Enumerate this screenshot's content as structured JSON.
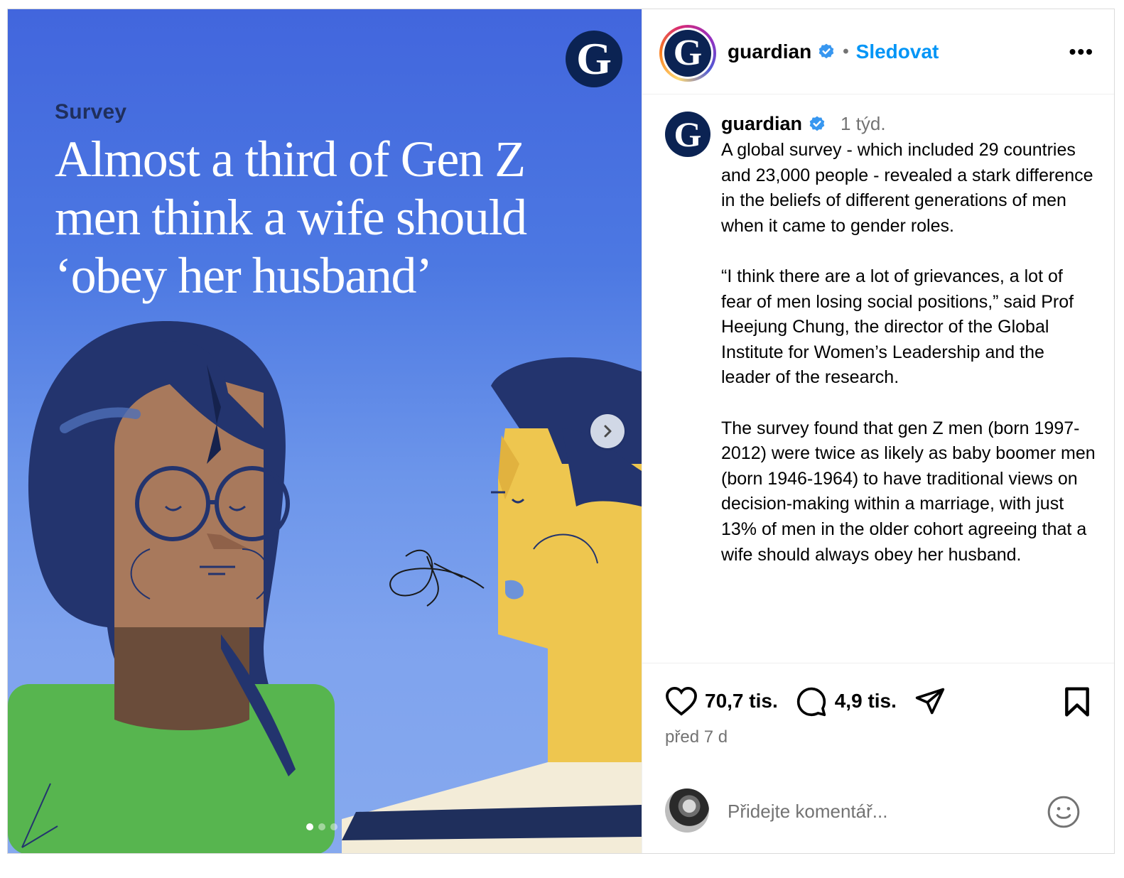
{
  "media": {
    "kicker": "Survey",
    "headline": "Almost a third of Gen Z men think a wife should ‘obey her husband’",
    "logo_letter": "G",
    "slide_count": 3,
    "active_slide": 1
  },
  "header": {
    "username": "guardian",
    "separator": "•",
    "follow_label": "Sledovat",
    "more_label": "•••",
    "avatar_letter": "G"
  },
  "caption": {
    "username": "guardian",
    "time": "1 týd.",
    "avatar_letter": "G",
    "text": "A global survey - which included 29 countries and 23,000 people - revealed a stark difference in the beliefs of different generations of men when it came to gender roles.\n\n“I think there are a lot of grievances, a lot of fear of men losing social positions,” said Prof Heejung Chung, the director of the Global Institute for Women’s Leadership and the leader of the research.\n\nThe survey found that gen Z men (born 1997-2012) were twice as likely as baby boomer men (born 1946-1964) to have traditional views on decision-making within a marriage, with just 13% of men in the older cohort agreeing that a wife should always obey her husband."
  },
  "actions": {
    "likes": "70,7 tis.",
    "comments": "4,9 tis.",
    "date": "před 7 d"
  },
  "comment": {
    "placeholder": "Přidejte komentář..."
  },
  "colors": {
    "brand_navy": "#0b2353",
    "follow_blue": "#0095f6",
    "verified_blue": "#3897f0",
    "muted": "#737373"
  },
  "icons": [
    "verified-badge-icon",
    "more-icon",
    "chevron-right-icon",
    "heart-icon",
    "comment-icon",
    "share-icon",
    "bookmark-icon",
    "emoji-icon"
  ]
}
